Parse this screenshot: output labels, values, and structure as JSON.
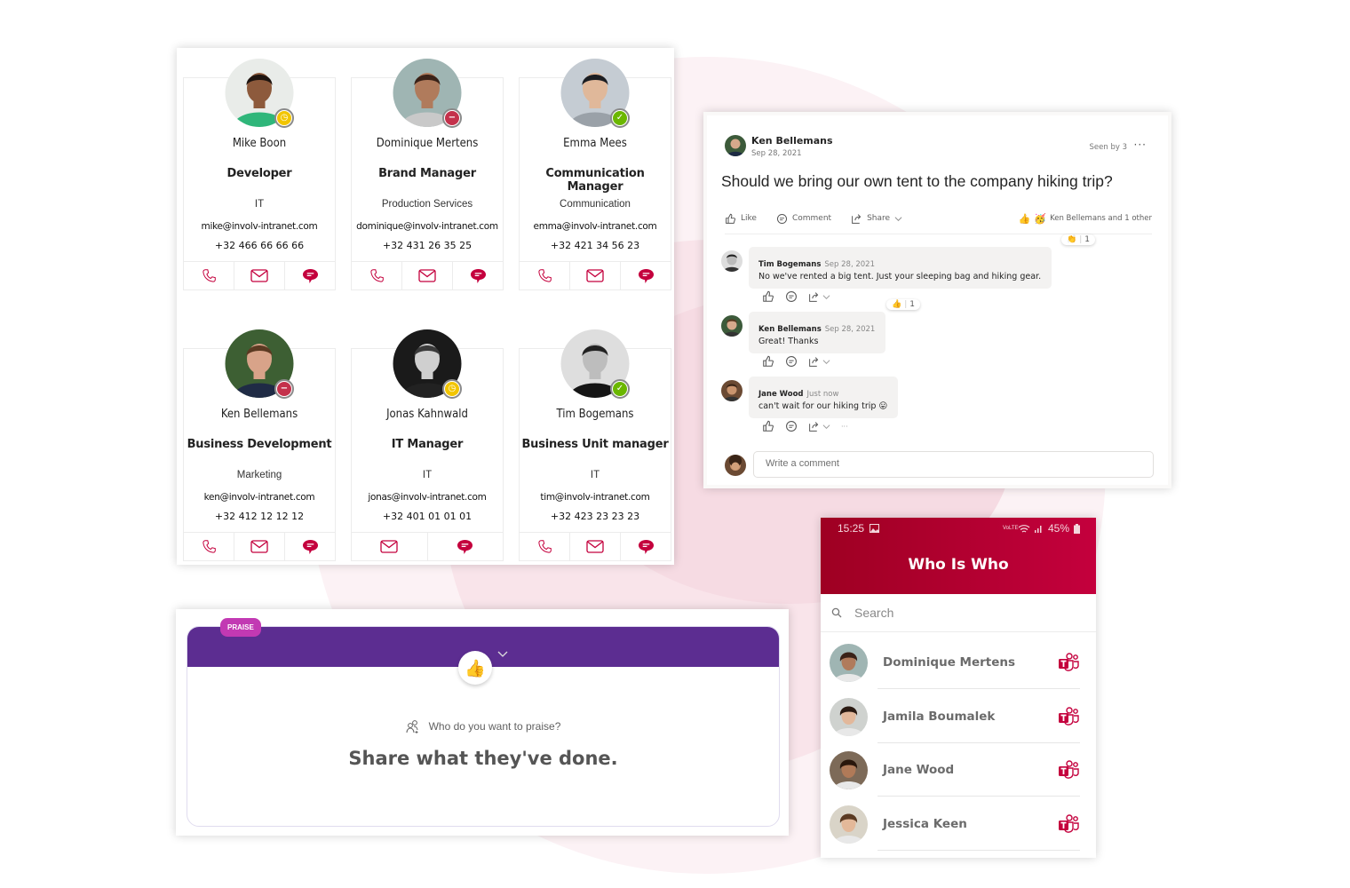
{
  "colors": {
    "brand_red": "#c4003d",
    "praise_purple": "#5c2d91",
    "praise_tag": "#c239b3",
    "status_away": "#f2c500",
    "status_busy": "#c4314b",
    "status_available": "#6bb700"
  },
  "directory": {
    "people": [
      {
        "name": "Mike Boon",
        "role": "Developer",
        "department": "IT",
        "email": "mike@involv-intranet.com",
        "phone": "+32 466 66 66 66",
        "status": "away",
        "actions": [
          "phone",
          "mail",
          "chat"
        ]
      },
      {
        "name": "Dominique Mertens",
        "role": "Brand Manager",
        "department": "Production Services",
        "email": "dominique@involv-intranet.com",
        "phone": "+32 431 26 35 25",
        "status": "busy",
        "actions": [
          "phone",
          "mail",
          "chat"
        ]
      },
      {
        "name": "Emma Mees",
        "role": "Communication Manager",
        "department": "Communication",
        "email": "emma@involv-intranet.com",
        "phone": "+32 421 34 56 23",
        "status": "available",
        "actions": [
          "phone",
          "mail",
          "chat"
        ]
      },
      {
        "name": "Ken Bellemans",
        "role": "Business Development",
        "department": "Marketing",
        "email": "ken@involv-intranet.com",
        "phone": "+32 412 12 12 12",
        "status": "busy",
        "actions": [
          "phone",
          "mail",
          "chat"
        ]
      },
      {
        "name": "Jonas Kahnwald",
        "role": "IT Manager",
        "department": "IT",
        "email": "jonas@involv-intranet.com",
        "phone": "+32 401 01 01 01",
        "status": "away",
        "actions": [
          "mail",
          "chat"
        ]
      },
      {
        "name": "Tim Bogemans",
        "role": "Business Unit manager",
        "department": "IT",
        "email": "tim@involv-intranet.com",
        "phone": "+32 423 23 23 23",
        "status": "available",
        "actions": [
          "phone",
          "mail",
          "chat"
        ]
      }
    ]
  },
  "post": {
    "author": "Ken Bellemans",
    "date": "Sep 28, 2021",
    "seen": "Seen by 3",
    "more": "···",
    "question": "Should we bring our own tent to the company hiking trip?",
    "like": "Like",
    "comment": "Comment",
    "share": "Share",
    "reactors": "Ken Bellemans and 1 other",
    "comments": [
      {
        "author": "Tim Bogemans",
        "time": "Sep 28, 2021",
        "text": "No we've rented a big tent. Just your sleeping bag and hiking gear.",
        "reaction": "👏",
        "reaction_count": "1"
      },
      {
        "author": "Ken Bellemans",
        "time": "Sep 28, 2021",
        "text": "Great! Thanks",
        "reaction": "👍",
        "reaction_count": "1"
      },
      {
        "author": "Jane Wood",
        "time": "Just now",
        "text": "can't wait for our hiking trip 😛",
        "reaction": "",
        "reaction_count": ""
      }
    ],
    "write_placeholder": "Write a comment",
    "tools_more": "···"
  },
  "praise": {
    "tag": "PRAISE",
    "who_prompt": "Who do you want to praise?",
    "share_prompt": "Share what they've done."
  },
  "mobile": {
    "time": "15:25",
    "network": "VoLTE",
    "battery": "45%",
    "title": "Who Is Who",
    "search_placeholder": "Search",
    "people": [
      {
        "name": "Dominique Mertens"
      },
      {
        "name": "Jamila Boumalek"
      },
      {
        "name": "Jane Wood"
      },
      {
        "name": "Jessica Keen"
      }
    ]
  }
}
